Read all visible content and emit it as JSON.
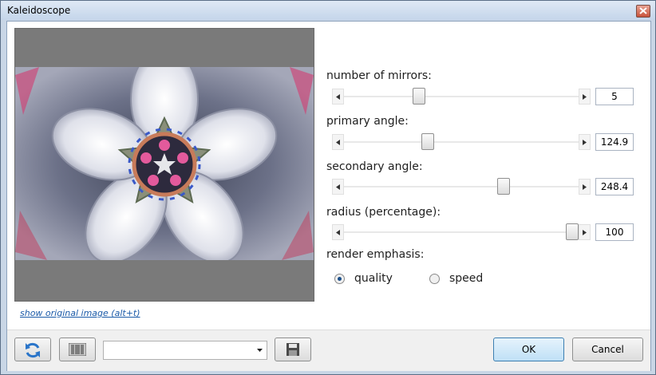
{
  "window": {
    "title": "Kaleidoscope",
    "close_icon": "close-icon"
  },
  "link": {
    "show_original": "show original image (alt+t)"
  },
  "controls": [
    {
      "label": "number of mirrors:",
      "value": "5",
      "fraction": 0.31
    },
    {
      "label": "primary angle:",
      "value": "124.9",
      "fraction": 0.35
    },
    {
      "label": "secondary angle:",
      "value": "248.4",
      "fraction": 0.69
    },
    {
      "label": "radius (percentage):",
      "value": "100",
      "fraction": 1.0
    }
  ],
  "render": {
    "label": "render emphasis:",
    "options": [
      "quality",
      "speed"
    ],
    "selected": "quality"
  },
  "bottom": {
    "reset_icon": "refresh-icon",
    "randomize_icon": "barcode-icon",
    "preset_value": "",
    "save_icon": "save-disk-icon",
    "ok_label": "OK",
    "cancel_label": "Cancel"
  },
  "colors": {
    "accent": "#3c7fb1",
    "link": "#1a5aa8",
    "background": "#7a7a7a"
  }
}
